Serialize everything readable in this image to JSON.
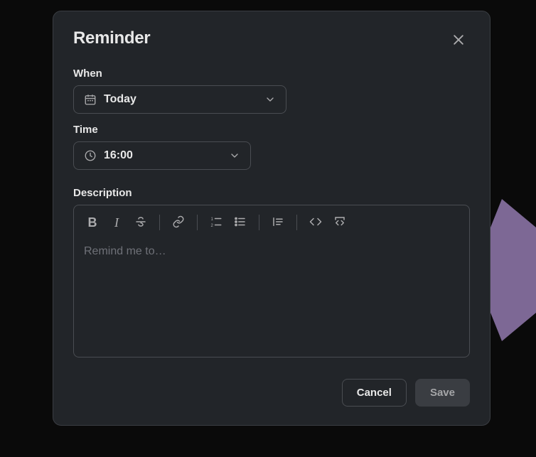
{
  "modal": {
    "title": "Reminder",
    "fields": {
      "when": {
        "label": "When",
        "value": "Today"
      },
      "time": {
        "label": "Time",
        "value": "16:00"
      },
      "description": {
        "label": "Description",
        "placeholder": "Remind me to…"
      }
    },
    "buttons": {
      "cancel": "Cancel",
      "save": "Save"
    }
  }
}
